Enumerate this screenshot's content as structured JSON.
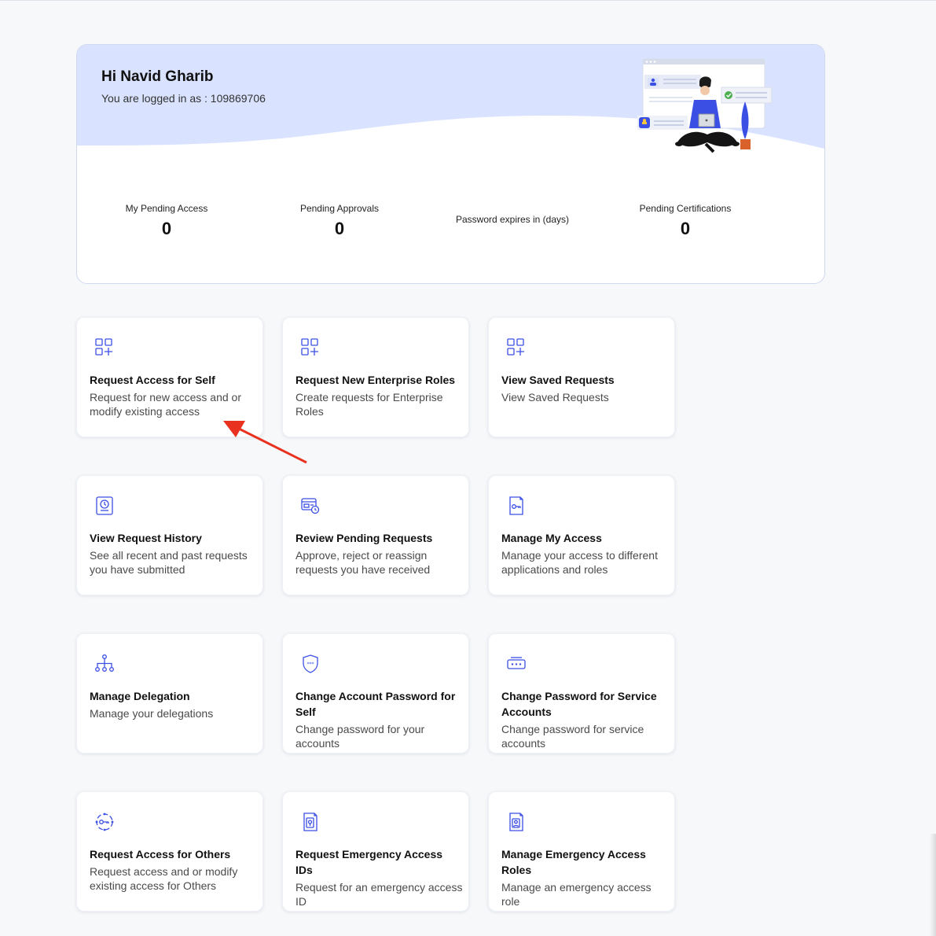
{
  "colors": {
    "accent": "#3b4fe4",
    "hero_band": "#d9e3ff",
    "annotation_arrow": "#e8321f"
  },
  "header": {
    "greeting": "Hi Navid Gharib",
    "login_text": "You are logged in as : 109869706"
  },
  "stats": [
    {
      "label": "My Pending Access",
      "value": "0"
    },
    {
      "label": "Pending Approvals",
      "value": "0"
    },
    {
      "label": "Password expires in (days)",
      "value": ""
    },
    {
      "label": "Pending Certifications",
      "value": "0"
    }
  ],
  "tiles": [
    {
      "icon": "grid-plus-icon",
      "title": "Request Access for Self",
      "desc": "Request for new access and or modify existing access"
    },
    {
      "icon": "grid-plus-icon",
      "title": "Request New Enterprise Roles",
      "desc": "Create requests for Enterprise Roles"
    },
    {
      "icon": "grid-plus-icon",
      "title": "View Saved Requests",
      "desc": "View Saved Requests"
    },
    {
      "icon": "history-clock-icon",
      "title": "View Request History",
      "desc": "See all recent and past requests you have submitted"
    },
    {
      "icon": "pending-review-icon",
      "title": "Review Pending Requests",
      "desc": "Approve, reject or reassign requests you have received"
    },
    {
      "icon": "key-card-icon",
      "title": "Manage My Access",
      "desc": "Manage your access to different applications and roles"
    },
    {
      "icon": "org-hierarchy-icon",
      "title": "Manage Delegation",
      "desc": "Manage your delegations"
    },
    {
      "icon": "shield-password-icon",
      "title": "Change Account Password for Self",
      "desc": "Change password for your accounts"
    },
    {
      "icon": "password-field-icon",
      "title": "Change Password for Service Accounts",
      "desc": "Change password for service accounts"
    },
    {
      "icon": "key-circle-icon",
      "title": "Request Access for Others",
      "desc": "Request access and or modify existing access for Others"
    },
    {
      "icon": "emergency-id-icon",
      "title": "Request Emergency Access IDs",
      "desc": "Request for an emergency access ID"
    },
    {
      "icon": "emergency-role-icon",
      "title": "Manage Emergency Access Roles",
      "desc": "Manage an emergency access role"
    }
  ]
}
